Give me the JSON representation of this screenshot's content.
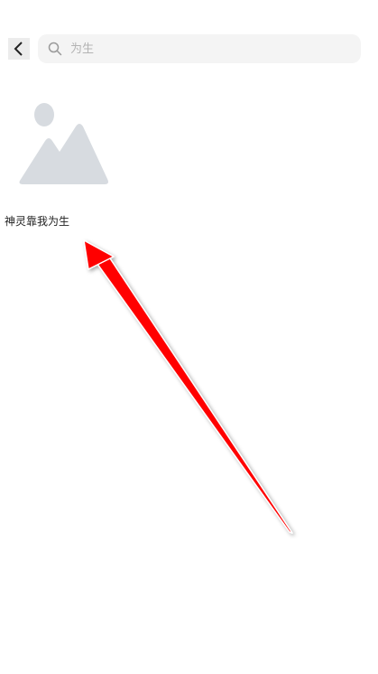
{
  "header": {
    "back_icon": "chevron-left-icon",
    "search": {
      "icon": "search-icon",
      "value": "",
      "placeholder": "为生"
    }
  },
  "results": [
    {
      "thumbnail_icon": "image-placeholder-icon",
      "title": "神灵靠我为生"
    }
  ],
  "annotation": {
    "arrow_color": "#ff0000"
  }
}
